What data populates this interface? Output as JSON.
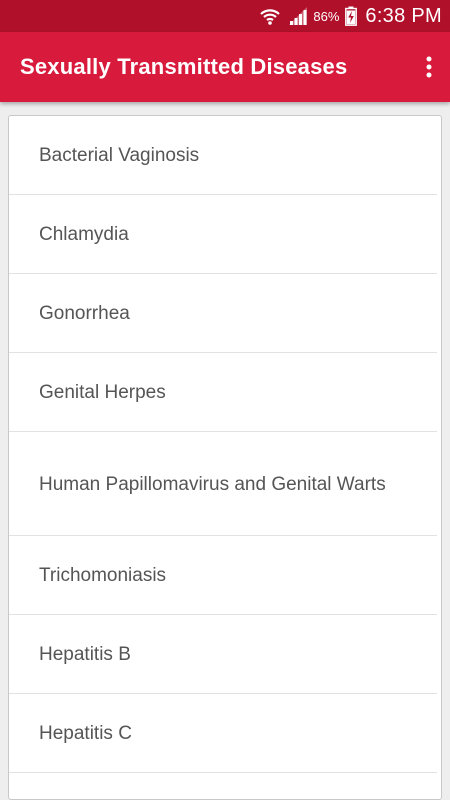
{
  "status_bar": {
    "battery_percent": "86%",
    "time": "6:38 PM",
    "icons": [
      "wifi-icon",
      "signal-icon",
      "battery-charging-icon"
    ]
  },
  "app_bar": {
    "title": "Sexually Transmitted Diseases",
    "overflow_icon": "more-vert-icon"
  },
  "list": {
    "items": [
      "Bacterial Vaginosis",
      "Chlamydia",
      "Gonorrhea",
      "Genital Herpes",
      "Human Papillomavirus and Genital Warts",
      "Trichomoniasis",
      "Hepatitis B",
      "Hepatitis C"
    ]
  },
  "colors": {
    "status_bar": "#b0102a",
    "app_bar": "#d81b3d",
    "item_text": "#555555",
    "background": "#eeeeee"
  }
}
